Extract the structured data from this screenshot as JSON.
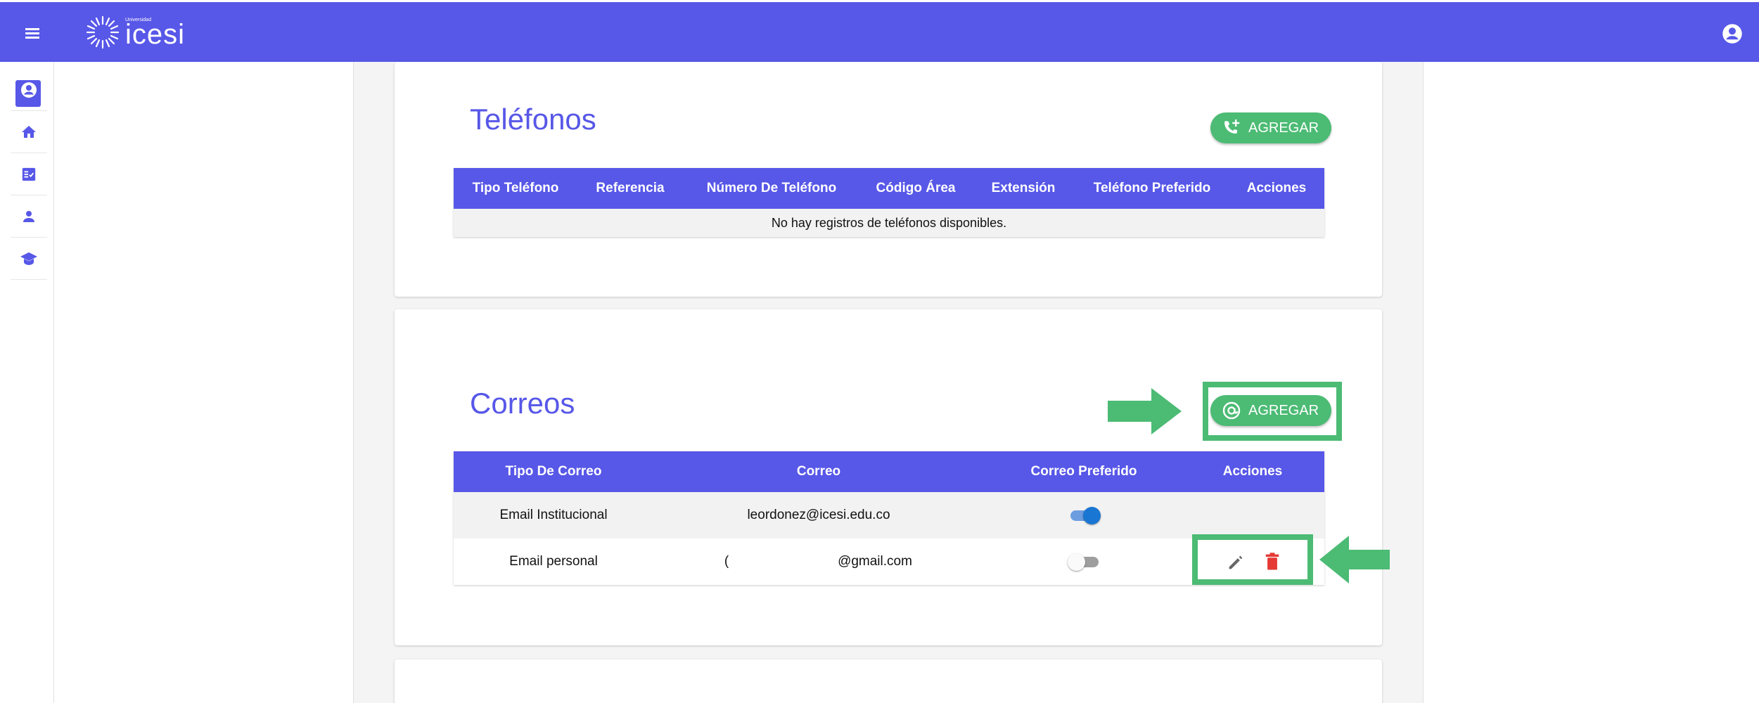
{
  "header": {
    "menu_icon": "hamburger-icon",
    "logo_small": "Universidad",
    "logo_text": "icesi",
    "account_icon": "account-circle-icon"
  },
  "sidebar": {
    "items": [
      {
        "icon": "account-circle-icon",
        "active": true
      },
      {
        "icon": "home-icon"
      },
      {
        "icon": "checklist-icon"
      },
      {
        "icon": "person-icon"
      },
      {
        "icon": "graduation-cap-icon"
      }
    ]
  },
  "phones": {
    "title": "Teléfonos",
    "add_label": "AGREGAR",
    "add_icon": "phone-add-icon",
    "columns": [
      "Tipo Teléfono",
      "Referencia",
      "Número De Teléfono",
      "Código Área",
      "Extensión",
      "Teléfono Preferido",
      "Acciones"
    ],
    "empty_message": "No hay registros de teléfonos disponibles."
  },
  "emails": {
    "title": "Correos",
    "add_label": "AGREGAR",
    "add_icon": "at-sign-icon",
    "columns": [
      "Tipo De Correo",
      "Correo",
      "Correo Preferido",
      "Acciones"
    ],
    "rows": [
      {
        "type": "Email Institucional",
        "email": "leordonez@icesi.edu.co",
        "preferred": true
      },
      {
        "type": "Email personal",
        "email_prefix": "(",
        "email": "@gmail.com",
        "preferred": false,
        "actions": [
          "pencil-icon",
          "trash-icon"
        ]
      }
    ]
  },
  "colors": {
    "primary": "#5757e8",
    "success": "#4cbb74",
    "danger": "#e53935",
    "toggle_on": "#1976d2"
  }
}
